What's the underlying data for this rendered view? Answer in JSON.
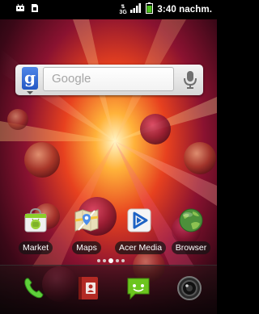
{
  "status_bar": {
    "time": "3:40 nachm.",
    "network_type": "3G",
    "notification_icons": [
      "usb-debugging-icon",
      "sd-card-icon"
    ],
    "status_icons": [
      "network-3g-icon",
      "signal-strength-icon",
      "battery-icon"
    ]
  },
  "search_widget": {
    "logo_letter": "g",
    "placeholder": "Google",
    "voice_icon": "microphone-icon"
  },
  "apps": [
    {
      "label": "Market",
      "icon": "market-icon"
    },
    {
      "label": "Maps",
      "icon": "maps-icon"
    },
    {
      "label": "Acer Media",
      "icon": "acer-media-icon"
    },
    {
      "label": "Browser",
      "icon": "browser-icon"
    }
  ],
  "page_indicator": {
    "pages": 5,
    "current": 3
  },
  "dock": {
    "items": [
      "phone-icon",
      "contacts-icon",
      "messaging-icon",
      "camera-icon"
    ]
  },
  "colors": {
    "status_bar": "#000000",
    "search_logo_blue": "#2f6ad6",
    "messaging_green": "#6cc51e",
    "acer_media_blue": "#1e63c4"
  }
}
